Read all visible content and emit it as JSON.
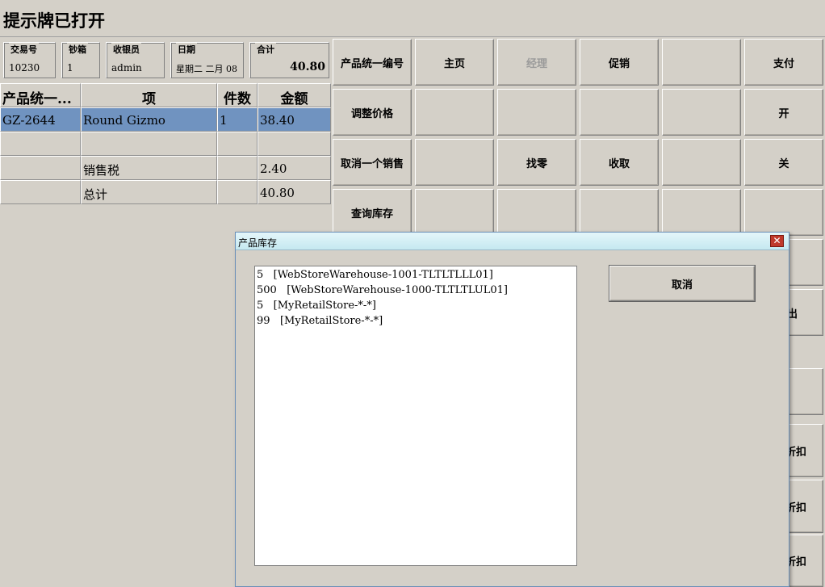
{
  "title": "提示牌已打开",
  "info": {
    "transaction": {
      "label": "交易号",
      "value": "10230"
    },
    "drawer": {
      "label": "钞箱",
      "value": "1"
    },
    "cashier": {
      "label": "收银员",
      "value": "admin"
    },
    "date": {
      "label": "日期",
      "value": "星期二 二月 08"
    },
    "total": {
      "label": "合计",
      "value": "40.80"
    }
  },
  "table": {
    "headers": [
      "产品统一...",
      "项",
      "件数",
      "金额"
    ],
    "rows": [
      [
        "GZ-2644",
        "Round Gizmo",
        "1",
        "38.40"
      ],
      [
        "",
        "",
        "",
        ""
      ],
      [
        "",
        "销售税",
        "",
        "2.40"
      ],
      [
        "",
        "总计",
        "",
        "40.80"
      ]
    ]
  },
  "buttons": {
    "b_product_id": "产品统一编号",
    "b_home": "主页",
    "b_manager": "经理",
    "b_promo": "促销",
    "b_pay": "支付",
    "b_adjust_price": "调整价格",
    "b_open": "开",
    "b_void_sale": "取消一个销售",
    "b_change": "找零",
    "b_collect": "收取",
    "b_close": "关",
    "b_query_stock": "查询库存",
    "b_partial_1": "出",
    "b_partial_2": "折扣",
    "b_partial_3": "折扣",
    "b_partial_4": "折扣"
  },
  "dialog": {
    "title": "产品库存",
    "close_icon": "close-icon",
    "items": [
      "5   [WebStoreWarehouse-1001-TLTLTLLL01]",
      "500   [WebStoreWarehouse-1000-TLTLTLUL01]",
      "5   [MyRetailStore-*-*]",
      "99   [MyRetailStore-*-*]"
    ],
    "cancel_label": "取消"
  },
  "colors": {
    "background": "#d4d0c8",
    "selected_row": "#7093c0",
    "dialog_title": "#d0eef4",
    "close_button": "#c0392b"
  }
}
